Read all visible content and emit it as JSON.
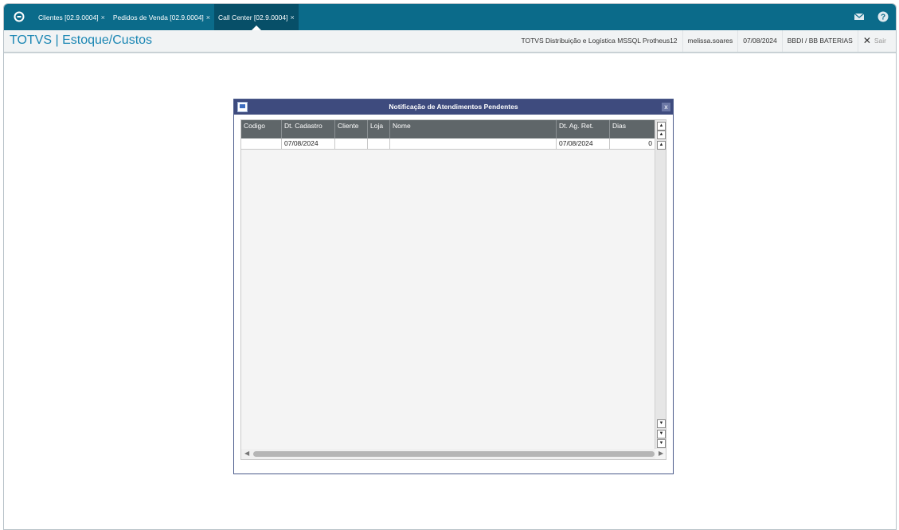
{
  "tabs": [
    {
      "label": "Clientes [02.9.0004]",
      "close": "×",
      "active": false
    },
    {
      "label": "Pedidos de Venda [02.9.0004]",
      "close": "×",
      "active": false
    },
    {
      "label": "Call Center [02.9.0004]",
      "close": "×",
      "active": true
    }
  ],
  "header": {
    "title": "TOTVS | Estoque/Custos",
    "environment": "TOTVS Distribuição e Logística MSSQL Protheus12",
    "user": "melissa.soares",
    "date": "07/08/2024",
    "branch": "BBDI / BB BATERIAS",
    "exit_label": "Sair"
  },
  "dialog": {
    "title": "Notificação de Atendimentos Pendentes",
    "close": "x",
    "columns": [
      "Codigo",
      "Dt. Cadastro",
      "Cliente",
      "Loja",
      "Nome",
      "Dt. Ag. Ret.",
      "Dias"
    ],
    "rows": [
      {
        "codigo": "",
        "dt_cadastro": "07/08/2024",
        "cliente": "",
        "loja": "",
        "nome": "",
        "dt_ag_ret": "07/08/2024",
        "dias": "0"
      }
    ]
  },
  "colors": {
    "topbar": "#0b6b8a",
    "title_blue": "#1a86b3",
    "dialog_title": "#3e4b7e",
    "grid_header": "#5f6669"
  },
  "icons": [
    "totvs-logo-icon",
    "mail-icon",
    "help-icon",
    "close-icon",
    "dialog-window-icon"
  ]
}
